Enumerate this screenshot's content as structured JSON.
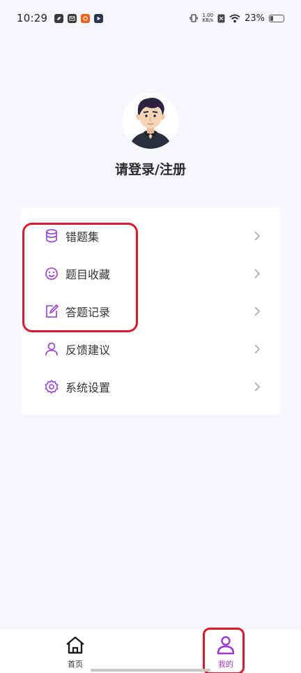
{
  "status_bar": {
    "time": "10:29",
    "net_speed_value": "1.00",
    "net_speed_unit": "KB/s",
    "battery_percent": "23%",
    "battery_level": 0.23,
    "notification_icons": [
      "app-icon-green",
      "mail-icon",
      "taobao-icon",
      "play-icon"
    ]
  },
  "profile": {
    "avatar_icon": "user-avatar-icon",
    "login_label": "请登录/注册"
  },
  "menu": {
    "items": [
      {
        "label": "错题集",
        "icon": "database-icon"
      },
      {
        "label": "题目收藏",
        "icon": "smile-icon"
      },
      {
        "label": "答题记录",
        "icon": "edit-icon"
      },
      {
        "label": "反馈建议",
        "icon": "user-icon"
      },
      {
        "label": "系统设置",
        "icon": "settings-icon"
      }
    ]
  },
  "bottom_nav": {
    "items": [
      {
        "label": "首页",
        "icon": "home-icon",
        "active": false
      },
      {
        "label": "我的",
        "icon": "user-icon",
        "active": true
      }
    ]
  },
  "colors": {
    "accent": "#9a37d6",
    "highlight": "#e0182c",
    "background": "#f7f8fd"
  }
}
